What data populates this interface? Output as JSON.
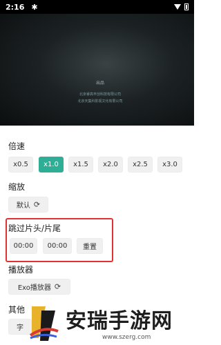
{
  "status_bar": {
    "time": "2:16",
    "notif_icon": "bug-icon"
  },
  "video": {
    "credits_title": "出品",
    "credits_lines": [
      "北京睿高丰创科技有限公司",
      "北京天集科影视文化有限公司"
    ]
  },
  "speed": {
    "label": "倍速",
    "options": [
      "x0.5",
      "x1.0",
      "x1.5",
      "x2.0",
      "x2.5",
      "x3.0"
    ],
    "selected": "x1.0"
  },
  "zoom": {
    "label": "缩放",
    "value": "默认"
  },
  "skip": {
    "label": "跳过片头/片尾",
    "opening": "00:00",
    "ending": "00:00",
    "reset_label": "重置"
  },
  "player": {
    "label": "播放器",
    "value": "Exo播放器"
  },
  "other": {
    "label_partial": "其他",
    "btn_partial": "字"
  },
  "watermark": {
    "text": "安瑞手游网",
    "url": "www.szerg.com"
  },
  "colors": {
    "accent": "#2fae96",
    "highlight": "#e0332f"
  }
}
